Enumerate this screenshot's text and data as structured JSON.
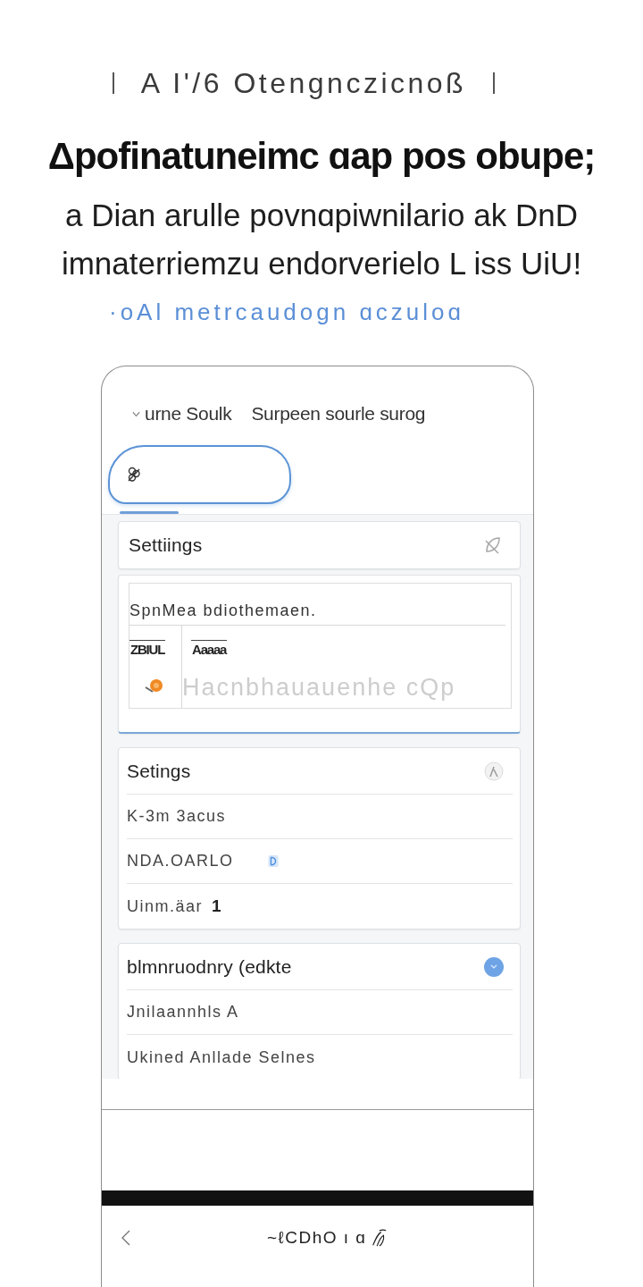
{
  "intro": {
    "tagline": "A I'/6 Otengnczicnoß",
    "headline": "Δpofinatuneimc ɑap pos obupe;",
    "paragraph": "a Dian arulle povnɑpiwnilario ak DnD imnaterriemzu endorverielo L iss UiU!",
    "link": "·oAl metrcaudogn ɑczuloɑ"
  },
  "phone": {
    "top_bar": {
      "title": "urne Soulk",
      "subtitle": "Surpeen sourle surog"
    },
    "cards": [
      {
        "kind": "title",
        "title": "Settiings"
      },
      {
        "kind": "editor",
        "focused": true,
        "label": "SpnMea bdiothemaen.",
        "toolbar": [
          "ZBIUL",
          "Aaaaa"
        ],
        "placeholder": "Hacnbhauauenhe cQp"
      },
      {
        "kind": "list",
        "title": "Setings",
        "rows": [
          {
            "kind": "plain",
            "label": "K-3m 3acus"
          },
          {
            "kind": "icon",
            "label": "NDA.OARLO"
          },
          {
            "kind": "value",
            "label": "Uinm.äar",
            "value": "1"
          }
        ]
      },
      {
        "kind": "list",
        "title": "blmnruodnry (edkte",
        "rows": [
          {
            "kind": "plain",
            "label": "Jnilaannhls A"
          },
          {
            "kind": "plain",
            "label": "Ukined Anllade Selnes"
          }
        ]
      }
    ],
    "bottom_bar": {
      "label": "~ℓCDhO ı ɑ"
    }
  }
}
